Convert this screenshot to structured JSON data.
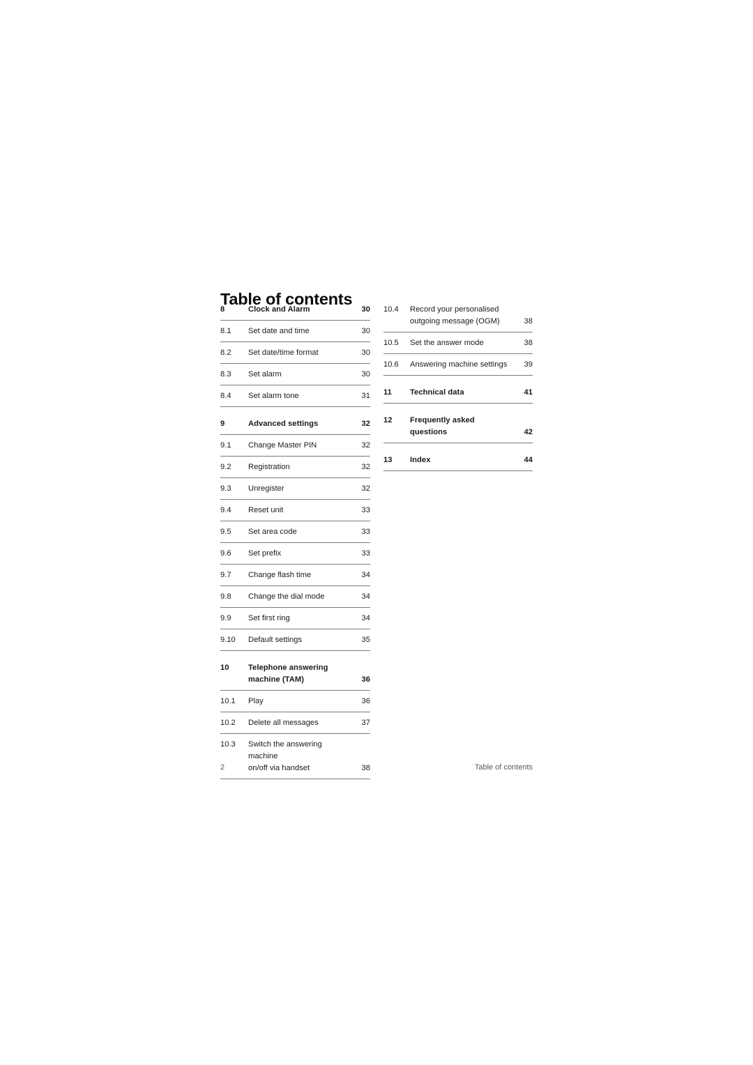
{
  "document": {
    "title": "Table of contents"
  },
  "toc": {
    "left_column": [
      {
        "number": "8",
        "lines": [
          "Clock and Alarm"
        ],
        "page": "30",
        "chapter": true,
        "spaced_top": false
      },
      {
        "number": "8.1",
        "lines": [
          "Set date and time"
        ],
        "page": "30",
        "chapter": false,
        "spaced_top": false
      },
      {
        "number": "8.2",
        "lines": [
          "Set date/time format"
        ],
        "page": "30",
        "chapter": false,
        "spaced_top": false
      },
      {
        "number": "8.3",
        "lines": [
          "Set alarm"
        ],
        "page": "30",
        "chapter": false,
        "spaced_top": false
      },
      {
        "number": "8.4",
        "lines": [
          "Set alarm tone"
        ],
        "page": "31",
        "chapter": false,
        "spaced_top": false
      },
      {
        "number": "9",
        "lines": [
          "Advanced settings"
        ],
        "page": "32",
        "chapter": true,
        "spaced_top": true
      },
      {
        "number": "9.1",
        "lines": [
          "Change Master PIN"
        ],
        "page": "32",
        "chapter": false,
        "spaced_top": false
      },
      {
        "number": "9.2",
        "lines": [
          "Registration"
        ],
        "page": "32",
        "chapter": false,
        "spaced_top": false
      },
      {
        "number": "9.3",
        "lines": [
          "Unregister"
        ],
        "page": "32",
        "chapter": false,
        "spaced_top": false
      },
      {
        "number": "9.4",
        "lines": [
          "Reset unit"
        ],
        "page": "33",
        "chapter": false,
        "spaced_top": false
      },
      {
        "number": "9.5",
        "lines": [
          "Set area code"
        ],
        "page": "33",
        "chapter": false,
        "spaced_top": false
      },
      {
        "number": "9.6",
        "lines": [
          "Set prefix"
        ],
        "page": "33",
        "chapter": false,
        "spaced_top": false
      },
      {
        "number": "9.7",
        "lines": [
          "Change flash time"
        ],
        "page": "34",
        "chapter": false,
        "spaced_top": false
      },
      {
        "number": "9.8",
        "lines": [
          "Change the dial mode"
        ],
        "page": "34",
        "chapter": false,
        "spaced_top": false
      },
      {
        "number": "9.9",
        "lines": [
          "Set first ring"
        ],
        "page": "34",
        "chapter": false,
        "spaced_top": false
      },
      {
        "number": "9.10",
        "lines": [
          "Default settings"
        ],
        "page": "35",
        "chapter": false,
        "spaced_top": false
      },
      {
        "number": "10",
        "lines": [
          "Telephone answering",
          "machine (TAM)"
        ],
        "page": "36",
        "chapter": true,
        "spaced_top": true
      },
      {
        "number": "10.1",
        "lines": [
          "Play"
        ],
        "page": "36",
        "chapter": false,
        "spaced_top": false
      },
      {
        "number": "10.2",
        "lines": [
          "Delete all messages"
        ],
        "page": "37",
        "chapter": false,
        "spaced_top": false
      },
      {
        "number": "10.3",
        "lines": [
          "Switch the answering machine",
          "on/off via handset"
        ],
        "page": "38",
        "chapter": false,
        "spaced_top": false
      }
    ],
    "right_column": [
      {
        "number": "10.4",
        "lines": [
          "Record your personalised",
          "outgoing message (OGM)"
        ],
        "page": "38",
        "chapter": false,
        "spaced_top": false
      },
      {
        "number": "10.5",
        "lines": [
          "Set the answer mode"
        ],
        "page": "38",
        "chapter": false,
        "spaced_top": false
      },
      {
        "number": "10.6",
        "lines": [
          "Answering machine settings"
        ],
        "page": "39",
        "chapter": false,
        "spaced_top": false
      },
      {
        "number": "11",
        "lines": [
          "Technical data"
        ],
        "page": "41",
        "chapter": true,
        "spaced_top": true
      },
      {
        "number": "12",
        "lines": [
          "Frequently asked",
          "questions"
        ],
        "page": "42",
        "chapter": true,
        "spaced_top": true
      },
      {
        "number": "13",
        "lines": [
          "Index"
        ],
        "page": "44",
        "chapter": true,
        "spaced_top": true
      }
    ]
  },
  "footer": {
    "page_number": "2",
    "running_head": "Table of contents"
  },
  "colors": {
    "text": "#1a1a1a",
    "rule": "#77787b",
    "footer_text": "#58585a",
    "background": "#ffffff"
  }
}
